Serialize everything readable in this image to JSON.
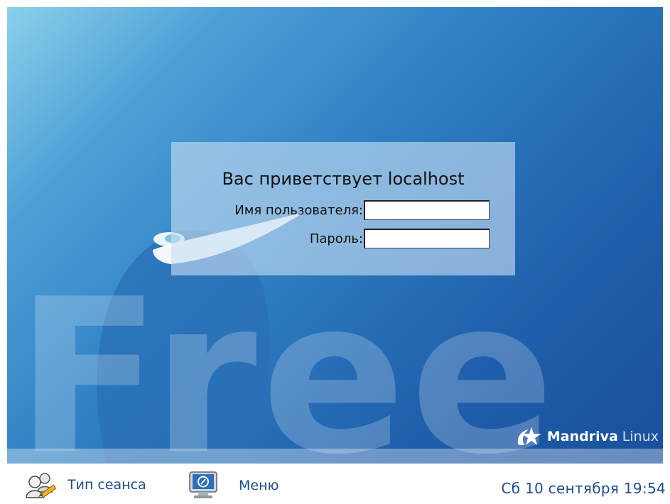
{
  "login": {
    "greeting": "Вас приветствует localhost",
    "username_label": "Имя пользователя:",
    "username_value": "",
    "password_label": "Пароль:",
    "password_value": ""
  },
  "wallpaper": {
    "text": "Free",
    "brand_name": "Mandriva",
    "brand_suffix": "Linux"
  },
  "bottom_bar": {
    "session_label": "Тип сеанса",
    "session_icon": "session-users-icon",
    "menu_label": "Меню",
    "menu_icon": "monitor-menu-icon",
    "clock": "Сб 10 сентября 19:54"
  },
  "colors": {
    "background_light": "#8ad0ea",
    "background_dark": "#1a4f9c",
    "label_blue": "#1f4d8c"
  }
}
